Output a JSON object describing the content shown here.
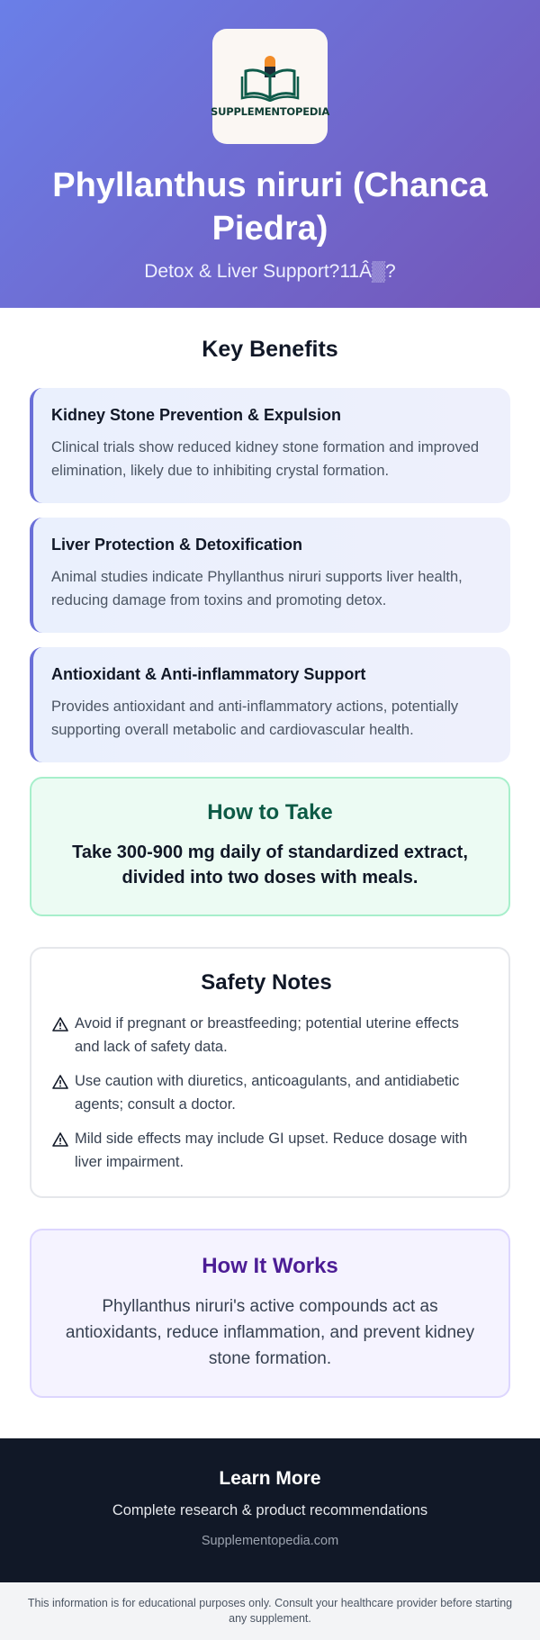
{
  "header": {
    "logo_text": "SUPPLEMENTOPEDIA",
    "title": "Phyllanthus niruri (Chanca Piedra)",
    "subtitle": "Detox & Liver Support?11Â▒?"
  },
  "benefits": {
    "heading": "Key Benefits",
    "items": [
      {
        "title": "Kidney Stone Prevention & Expulsion",
        "text": "Clinical trials show reduced kidney stone formation and improved elimination, likely due to inhibiting crystal formation."
      },
      {
        "title": "Liver Protection & Detoxification",
        "text": "Animal studies indicate Phyllanthus niruri supports liver health, reducing damage from toxins and promoting detox."
      },
      {
        "title": "Antioxidant & Anti-inflammatory Support",
        "text": "Provides antioxidant and anti-inflammatory actions, potentially supporting overall metabolic and cardiovascular health."
      }
    ]
  },
  "how_to_take": {
    "heading": "How to Take",
    "text": "Take 300-900 mg daily of standardized extract, divided into two doses with meals."
  },
  "safety": {
    "heading": "Safety Notes",
    "icon": "warning-icon",
    "items": [
      "Avoid if pregnant or breastfeeding; potential uterine effects and lack of safety data.",
      "Use caution with diuretics, anticoagulants, and antidiabetic agents; consult a doctor.",
      "Mild side effects may include GI upset. Reduce dosage with liver impairment."
    ]
  },
  "how_it_works": {
    "heading": "How It Works",
    "text": "Phyllanthus niruri's active compounds act as antioxidants, reduce inflammation, and prevent kidney stone formation."
  },
  "footer": {
    "title": "Learn More",
    "subtitle": "Complete research & product recommendations",
    "link": "Supplementopedia.com"
  },
  "disclaimer": "This information is for educational purposes only. Consult your healthcare provider before starting any supplement.",
  "colors": {
    "header_gradient_start": "#6a7fe8",
    "header_gradient_end": "#7456b8",
    "benefit_accent": "#6a6fd8",
    "take_title": "#0d5b46",
    "works_title": "#4c1d95",
    "footer_bg": "#111827"
  }
}
